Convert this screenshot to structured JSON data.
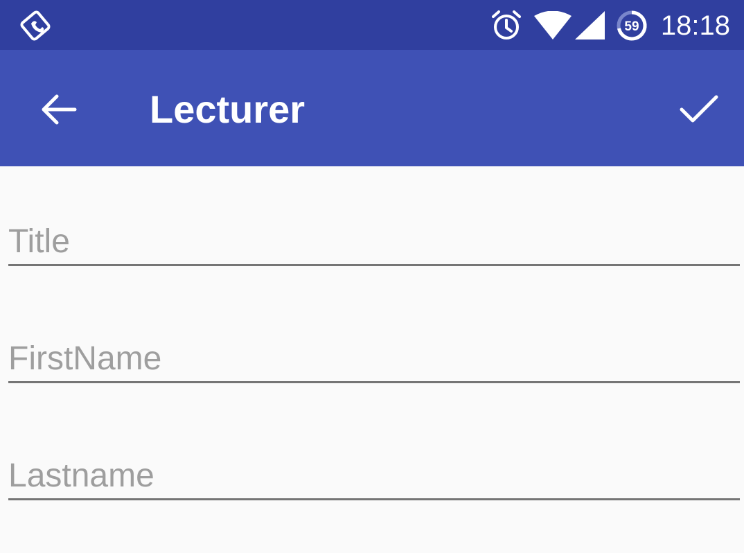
{
  "status_bar": {
    "time": "18:18",
    "battery_level": "59",
    "icons": [
      "phone-vibrate-icon",
      "alarm-icon",
      "wifi-icon",
      "cell-signal-icon",
      "battery-saver-icon"
    ]
  },
  "toolbar": {
    "title": "Lecturer",
    "back_icon": "arrow-back-icon",
    "confirm_icon": "check-icon"
  },
  "form": {
    "fields": [
      {
        "placeholder": "Title",
        "value": ""
      },
      {
        "placeholder": "FirstName",
        "value": ""
      },
      {
        "placeholder": "Lastname",
        "value": ""
      }
    ]
  },
  "colors": {
    "status_bar": "#303f9f",
    "app_bar": "#3f51b5",
    "background": "#fafafa",
    "placeholder": "#9e9e9e",
    "underline": "#757575"
  }
}
